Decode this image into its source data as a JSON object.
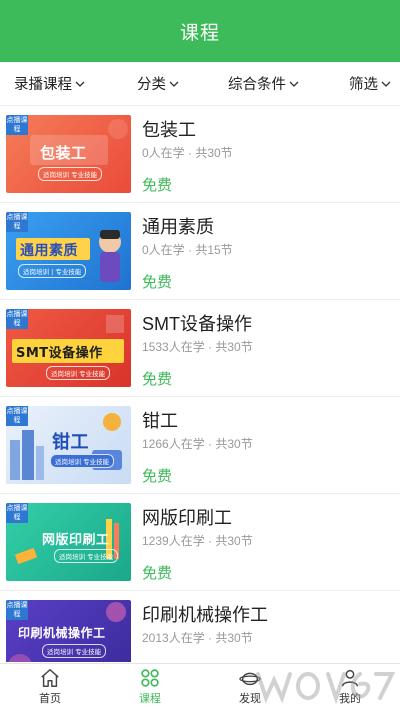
{
  "header": {
    "title": "课程"
  },
  "filters": [
    {
      "label": "录播课程"
    },
    {
      "label": "分类"
    },
    {
      "label": "综合条件"
    },
    {
      "label": "筛选"
    }
  ],
  "courses": [
    {
      "title": "包装工",
      "meta": "0人在学 · 共30节",
      "price": "免费",
      "thumb_title": "包装工",
      "thumb_sub": "适岗培训 专业技能",
      "tag": "点播课程",
      "color": "#f26b4a"
    },
    {
      "title": "通用素质",
      "meta": "0人在学 · 共15节",
      "price": "免费",
      "thumb_title": "通用素质",
      "thumb_sub": "适岗培训 | 专业技能",
      "tag": "点播课程",
      "color": "#2f8ee6"
    },
    {
      "title": "SMT设备操作",
      "meta": "1533人在学 · 共30节",
      "price": "免费",
      "thumb_title": "SMT设备操作",
      "thumb_sub": "适岗培训 专业技能",
      "tag": "点播课程",
      "color": "#e8493c"
    },
    {
      "title": "钳工",
      "meta": "1266人在学 · 共30节",
      "price": "免费",
      "thumb_title": "钳工",
      "thumb_sub": "适岗培训 专业技能",
      "tag": "点播课程",
      "color": "#3b6fd6"
    },
    {
      "title": "网版印刷工",
      "meta": "1239人在学 · 共30节",
      "price": "免费",
      "thumb_title": "网版印刷工",
      "thumb_sub": "适岗培训 专业技能",
      "tag": "点播课程",
      "color": "#2cc0a0"
    },
    {
      "title": "印刷机械操作工",
      "meta": "2013人在学 · 共30节",
      "price": "免费",
      "thumb_title": "印刷机械操作工",
      "thumb_sub": "适岗培训 专业技能",
      "tag": "点播课程",
      "color": "#4a3fb8"
    }
  ],
  "tabbar": [
    {
      "label": "首页",
      "icon": "home-icon"
    },
    {
      "label": "课程",
      "icon": "course-grid-icon",
      "active": true
    },
    {
      "label": "发现",
      "icon": "discover-icon"
    },
    {
      "label": "我的",
      "icon": "profile-icon"
    }
  ],
  "colors": {
    "primary": "#3dbb5a",
    "divider": "#efefef"
  }
}
